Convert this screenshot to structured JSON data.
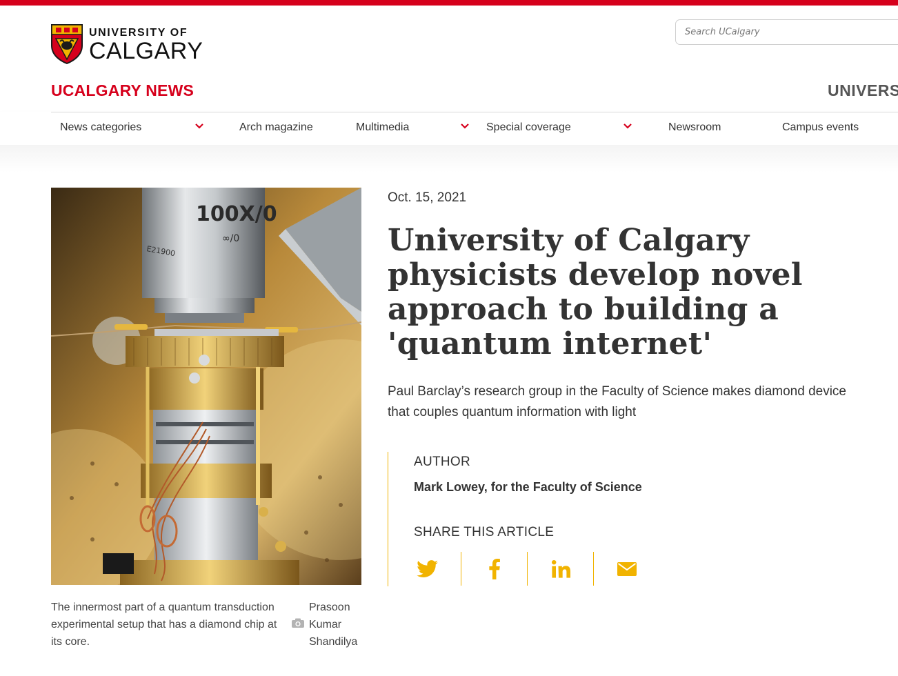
{
  "header": {
    "logo": {
      "line1": "UNIVERSITY OF",
      "line2": "CALGARY"
    },
    "search": {
      "placeholder": "Search UCalgary",
      "value": ""
    },
    "site_title": "UCALGARY NEWS",
    "university_link": "UNIVERSITY"
  },
  "nav": {
    "items": [
      {
        "label": "News categories",
        "has_dropdown": true
      },
      {
        "label": "Arch magazine",
        "has_dropdown": false
      },
      {
        "label": "Multimedia",
        "has_dropdown": true
      },
      {
        "label": "Special coverage",
        "has_dropdown": true
      },
      {
        "label": "Newsroom",
        "has_dropdown": false
      },
      {
        "label": "Campus events",
        "has_dropdown": false
      }
    ]
  },
  "article": {
    "date": "Oct. 15, 2021",
    "headline": "University of Calgary physicists develop novel approach to building a 'quantum internet'",
    "dek": "Paul Barclay’s research group in the Faculty of Science makes diamond device that couples quantum information with light",
    "image": {
      "caption": "The innermost part of a quantum transduction experimental setup that has a diamond chip at its core.",
      "credit": "Prasoon Kumar Shandilya",
      "lens_text_1": "100X/0",
      "lens_text_2": "∞/0",
      "lens_text_3": "E21900"
    },
    "author_label": "AUTHOR",
    "author_name": "Mark Lowey, for the Faculty of Science",
    "share_label": "SHARE THIS ARTICLE",
    "share_icons": [
      "twitter-icon",
      "facebook-icon",
      "linkedin-icon",
      "email-icon"
    ]
  },
  "colors": {
    "brand_red": "#d6001c",
    "accent_gold": "#f1b300",
    "text": "#333333"
  }
}
